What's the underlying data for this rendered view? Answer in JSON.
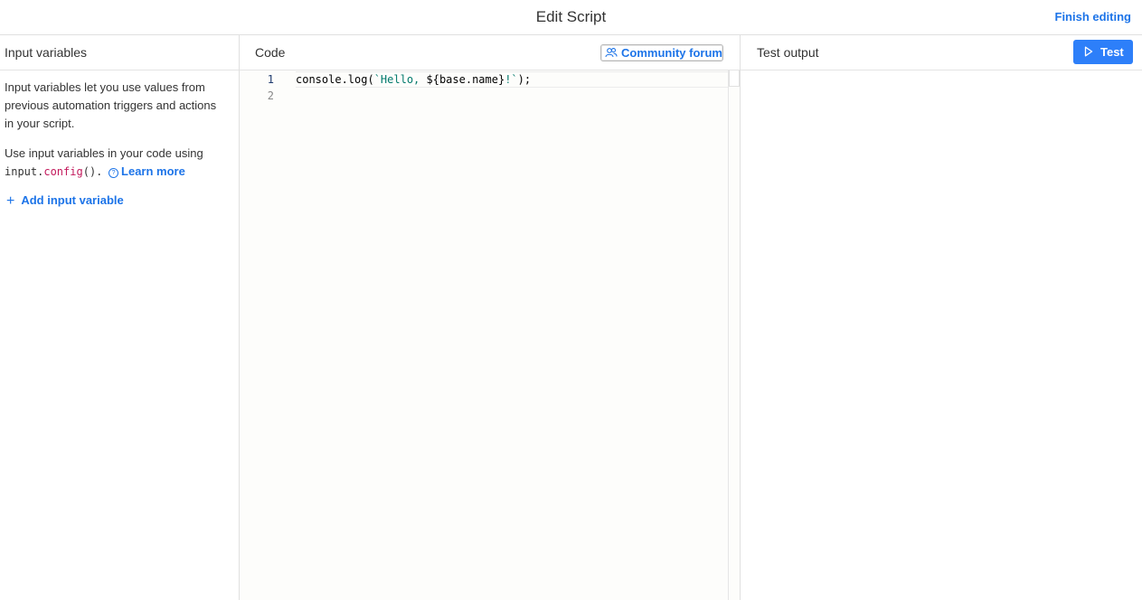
{
  "header": {
    "title": "Edit Script",
    "finish_label": "Finish editing"
  },
  "input_panel": {
    "title": "Input variables",
    "description": "Input variables let you use values from previous automation triggers and actions in your script.",
    "usage_prefix": "Use input variables in your code using",
    "code_obj": "input.",
    "code_fn": "config",
    "code_suffix": "().",
    "learn_more": "Learn more",
    "add_label": "Add input variable"
  },
  "code_panel": {
    "title": "Code",
    "community_label": "Community forum",
    "lines": [
      {
        "number": "1",
        "parts": {
          "p1": "console.log(",
          "p2": "`Hello, ",
          "p3": "${base.name}",
          "p4": "!`",
          "p5": ");"
        }
      },
      {
        "number": "2"
      }
    ]
  },
  "output_panel": {
    "title": "Test output",
    "test_label": "Test"
  },
  "colors": {
    "accent": "#1d74e8",
    "test_button": "#2d7ff9",
    "keyword": "#c2185b",
    "string": "#00796b"
  }
}
